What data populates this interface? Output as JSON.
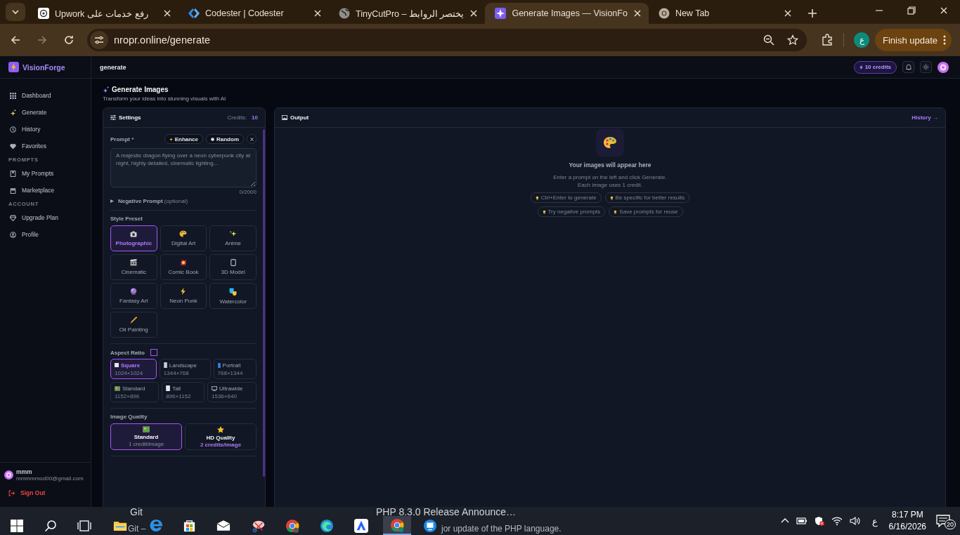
{
  "browser": {
    "tabs": [
      {
        "title": "رفع خدمات على Upwork",
        "selected": false
      },
      {
        "title": "Codester | Codester",
        "selected": false
      },
      {
        "title": "TinyCutPro – يختصر الروابط",
        "selected": false
      },
      {
        "title": "Generate Images — VisionFo",
        "selected": true
      },
      {
        "title": "New Tab",
        "selected": false
      }
    ],
    "address": "nropr.online/generate",
    "profile": "ع",
    "update_button": "Finish update"
  },
  "sidebar": {
    "brand": "VisionForge",
    "sections": [
      {
        "items": [
          {
            "label": "Dashboard",
            "selected": false
          },
          {
            "label": "Generate",
            "selected": false
          },
          {
            "label": "History",
            "selected": false
          },
          {
            "label": "Favorites",
            "selected": false
          }
        ]
      },
      {
        "heading": "PROMPTS",
        "items": [
          {
            "label": "My Prompts",
            "selected": false
          },
          {
            "label": "Marketplace",
            "selected": false
          }
        ]
      },
      {
        "heading": "ACCOUNT",
        "items": [
          {
            "label": "Upgrade Plan",
            "selected": false
          },
          {
            "label": "Profile",
            "selected": false
          }
        ]
      }
    ],
    "user": {
      "name": "mmm",
      "email": "mmmmmod00@gmail.com"
    },
    "sign_out": "Sign Out"
  },
  "topbar": {
    "page": "generate",
    "credits": "10 credits"
  },
  "page": {
    "title": "Generate Images",
    "subtitle": "Transform your ideas into stunning visuals with AI"
  },
  "settings": {
    "title": "Settings",
    "credits_label": "Credits:",
    "credits": "10",
    "prompt": {
      "label": "Prompt *",
      "buttons": [
        "Enhance",
        "Random"
      ],
      "placeholder": "A majestic dragon flying over a neon cyberpunk city at night, highly detailed, cinematic lighting...",
      "counter": "0/2000"
    },
    "negative_prompt": {
      "label": "Negative Prompt",
      "hint": "(optional)",
      "expanded": false
    },
    "style_preset": {
      "label": "Style Preset",
      "options": [
        {
          "label": "Photographic",
          "selected": true
        },
        {
          "label": "Digital Art",
          "selected": false
        },
        {
          "label": "Anime",
          "selected": false
        },
        {
          "label": "Cinematic",
          "selected": false
        },
        {
          "label": "Comic Book",
          "selected": false
        },
        {
          "label": "3D Model",
          "selected": false
        },
        {
          "label": "Fantasy Art",
          "selected": false
        },
        {
          "label": "Neon Punk",
          "selected": false
        },
        {
          "label": "Watercolor",
          "selected": false
        },
        {
          "label": "Oil Painting",
          "selected": false
        }
      ]
    },
    "aspect_ratio": {
      "label": "Aspect Ratio",
      "options": [
        {
          "label": "Square",
          "size": "1024×1024",
          "selected": true
        },
        {
          "label": "Landscape",
          "size": "1344×768",
          "selected": false
        },
        {
          "label": "Portrait",
          "size": "768×1344",
          "selected": false
        },
        {
          "label": "Standard",
          "size": "1152×896",
          "selected": false
        },
        {
          "label": "Tall",
          "size": "896×1152",
          "selected": false
        },
        {
          "label": "Ultrawide",
          "size": "1536×640",
          "selected": false
        }
      ]
    },
    "image_quality": {
      "label": "Image Quality",
      "options": [
        {
          "label": "Standard",
          "cost": "1 credit/image",
          "selected": true
        },
        {
          "label": "HD Quality",
          "cost": "2 credits/image",
          "selected": false
        }
      ]
    }
  },
  "output": {
    "title": "Output",
    "history_link": "History →",
    "empty_title": "Your images will appear here",
    "empty_text": [
      "Enter a prompt on the left and click Generate.",
      "Each image uses 1 credit."
    ],
    "tips": [
      "Ctrl+Enter to generate",
      "Be specific for better results",
      "Try negative prompts",
      "Save prompts for reuse"
    ]
  },
  "taskbar": {
    "previews": [
      {
        "title": "Git",
        "subtitle": "Git –"
      },
      {
        "title": "PHP 8.3.0 Release Announce…",
        "subtitle": "jor update of the PHP language."
      }
    ],
    "language": "ع",
    "time": "8:17 PM",
    "date": "6/16/2026",
    "notifications": "20"
  }
}
